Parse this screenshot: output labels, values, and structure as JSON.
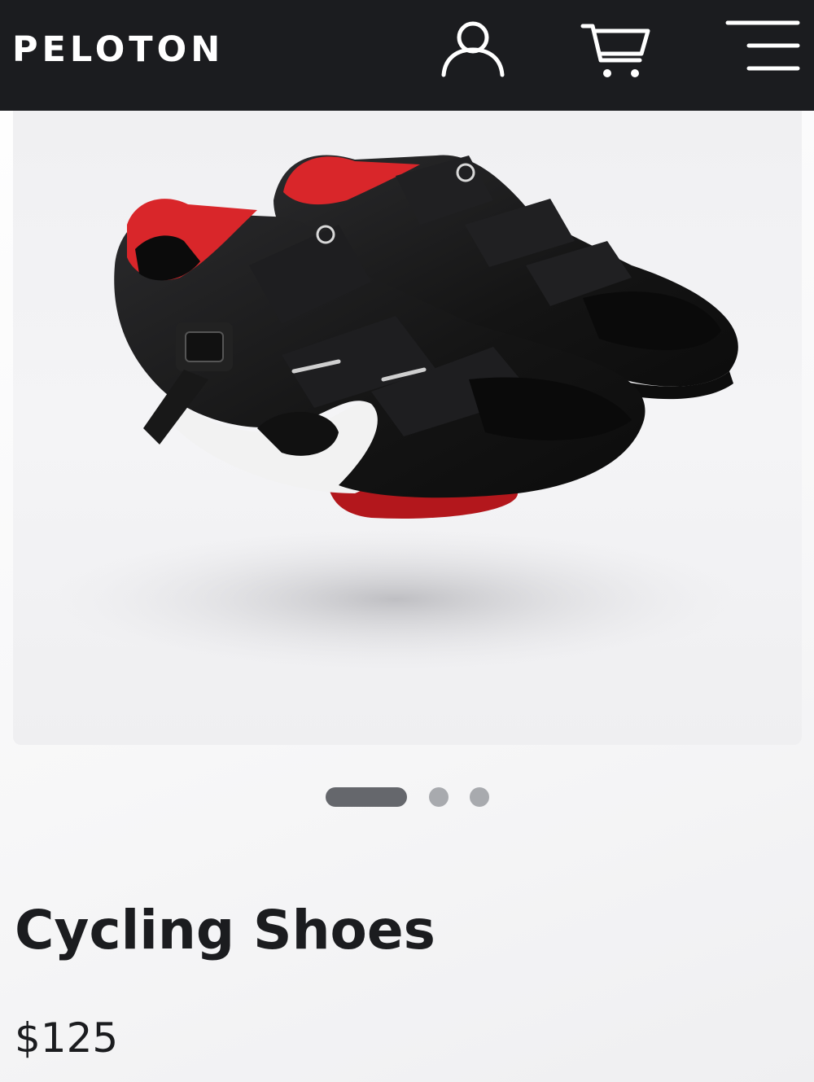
{
  "header": {
    "brand": "PELOTON",
    "icons": [
      "account-icon",
      "cart-icon",
      "menu-icon"
    ],
    "background_color": "#1b1c1f"
  },
  "gallery": {
    "image": "cycling-shoes-photo",
    "slide_count": 3,
    "active_slide": 1
  },
  "product": {
    "title": "Cycling Shoes",
    "price": "$125"
  },
  "colors": {
    "shoe_black": "#141414",
    "accent_red": "#d9262a",
    "text": "#1b1c1f"
  }
}
